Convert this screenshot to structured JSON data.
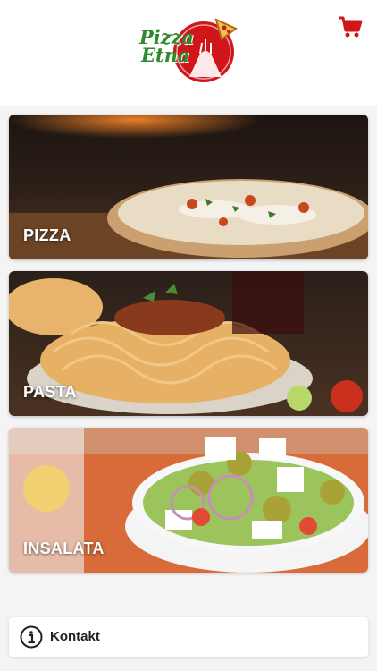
{
  "header": {
    "logo_line1": "Pizza",
    "logo_line2": "Etna",
    "cart_icon": "shopping-cart-icon"
  },
  "categories": [
    {
      "label": "PIZZA"
    },
    {
      "label": "PASTA"
    },
    {
      "label": "INSALATA"
    }
  ],
  "footer": {
    "contact_label": "Kontakt",
    "contact_icon": "info-icon"
  },
  "colors": {
    "accent_red": "#d0161a",
    "logo_green": "#2f8a2f"
  }
}
